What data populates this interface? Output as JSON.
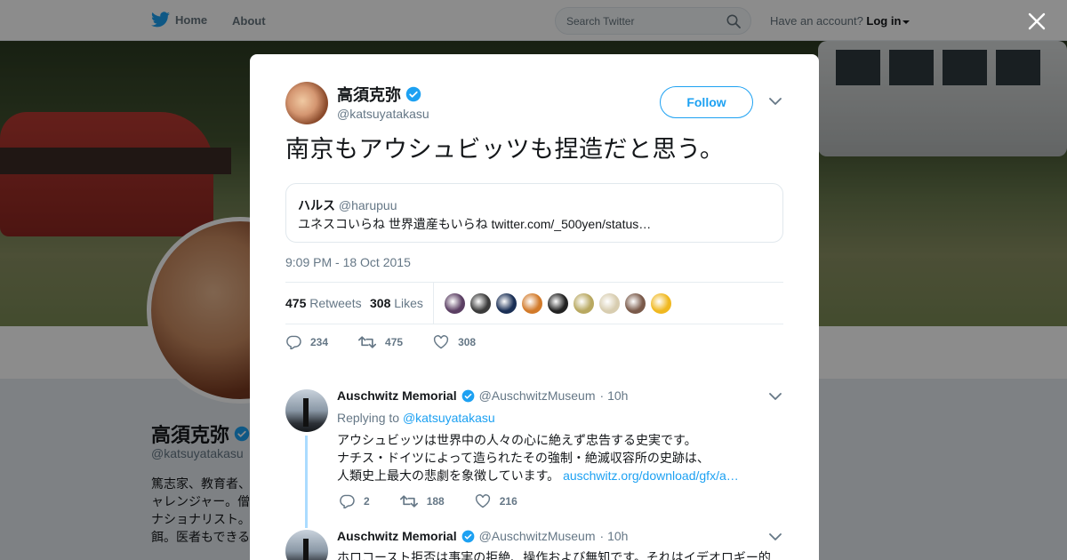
{
  "topbar": {
    "home_label": "Home",
    "about_label": "About",
    "search_placeholder": "Search Twitter",
    "account_prompt": "Have an account?",
    "login_label": "Log in"
  },
  "profile": {
    "name": "高須克弥",
    "handle": "@katsuyatakasu",
    "bio_lines": [
      "篤志家、教育者、",
      "ャレンジャー。僧",
      "ナショナリスト。",
      "餌。医者もできる"
    ]
  },
  "tweet": {
    "name": "高須克弥",
    "handle": "@katsuyatakasu",
    "follow_label": "Follow",
    "text": "南京もアウシュビッツも捏造だと思う。",
    "quote": {
      "name": "ハルス",
      "handle": "@harupuu",
      "text": "ユネスコいらね 世界遺産もいらね twitter.com/_500yen/status…"
    },
    "time": "9:09 PM - 18 Oct 2015",
    "retweets_count": "475",
    "retweets_label": "Retweets",
    "likes_count": "308",
    "likes_label": "Likes",
    "actions": {
      "replies": "234",
      "retweets": "475",
      "likes": "308"
    },
    "liker_colors": [
      "#5b3f63",
      "#3b3b3b",
      "#1a2f55",
      "#d27a2a",
      "#222222",
      "#b8a860",
      "#d8cdb0",
      "#7a5a4a",
      "#f0b820"
    ]
  },
  "replies": [
    {
      "name": "Auschwitz Memorial",
      "handle": "@AuschwitzMuseum",
      "time": "· 10h",
      "replying_prefix": "Replying to",
      "replying_to": "@katsuyatakasu",
      "lines": [
        "アウシュビッツは世界中の人々の心に絶えず忠告する史実です。",
        "ナチス・ドイツによって造られたその強制・絶滅収容所の史跡は、",
        "人類史上最大の悲劇を象徴しています。"
      ],
      "link": "auschwitz.org/download/gfx/a…",
      "replies": "2",
      "retweets": "188",
      "likes": "216"
    },
    {
      "name": "Auschwitz Memorial",
      "handle": "@AuschwitzMuseum",
      "time": "· 10h",
      "first_line": "ホロコースト拒否は事実の拒絶、操作および無知です。それはイデオロギー的"
    }
  ]
}
